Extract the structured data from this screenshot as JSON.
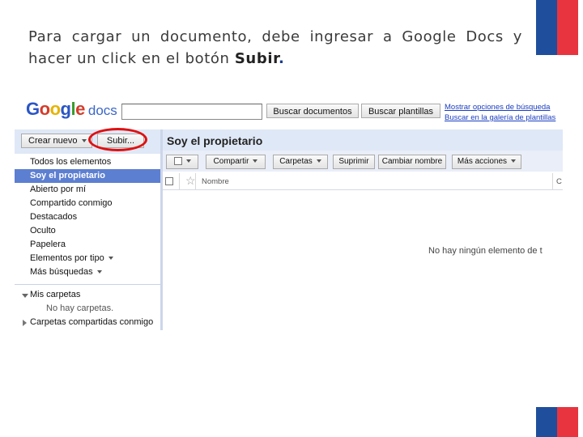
{
  "slide": {
    "instruction_prefix": "Para cargar un documento, debe ingresar a Google Docs y hacer un click en el botón ",
    "instruction_bold": "Subir",
    "instruction_suffix": "."
  },
  "colors": {
    "flag_blue": "#1f4e9c",
    "flag_red": "#e8343f",
    "highlight_ring": "#e01010",
    "nav_active": "#5d7fd1",
    "header_bg": "#dfe8f6"
  },
  "app": {
    "logo_google": "Google",
    "logo_docs": "docs",
    "search": {
      "value": "",
      "search_button": "Buscar documentos",
      "templates_button": "Buscar plantillas"
    },
    "links": {
      "options": "Mostrar opciones de búsqueda",
      "gallery": "Buscar en la galería de plantillas"
    },
    "sidebar": {
      "create_button": "Crear nuevo",
      "upload_button": "Subir...",
      "items": [
        {
          "label": "Todos los elementos",
          "active": false
        },
        {
          "label": "Soy el propietario",
          "active": true
        },
        {
          "label": "Abierto por mí",
          "active": false
        },
        {
          "label": "Compartido conmigo",
          "active": false
        },
        {
          "label": "Destacados",
          "active": false
        },
        {
          "label": "Oculto",
          "active": false
        },
        {
          "label": "Papelera",
          "active": false
        },
        {
          "label": "Elementos por tipo",
          "active": false
        },
        {
          "label": "Más búsquedas",
          "active": false
        }
      ],
      "folders": {
        "my_folders": "Mis carpetas",
        "no_folders": "No hay carpetas.",
        "shared_folders": "Carpetas compartidas conmigo"
      }
    },
    "main": {
      "title": "Soy el propietario",
      "toolbar": {
        "share": "Compartir",
        "folders": "Carpetas",
        "delete": "Suprimir",
        "rename": "Cambiar nombre",
        "more": "Más acciones"
      },
      "columns": {
        "name": "Nombre",
        "other": "C"
      },
      "empty_message": "No hay ningún elemento de t"
    }
  }
}
